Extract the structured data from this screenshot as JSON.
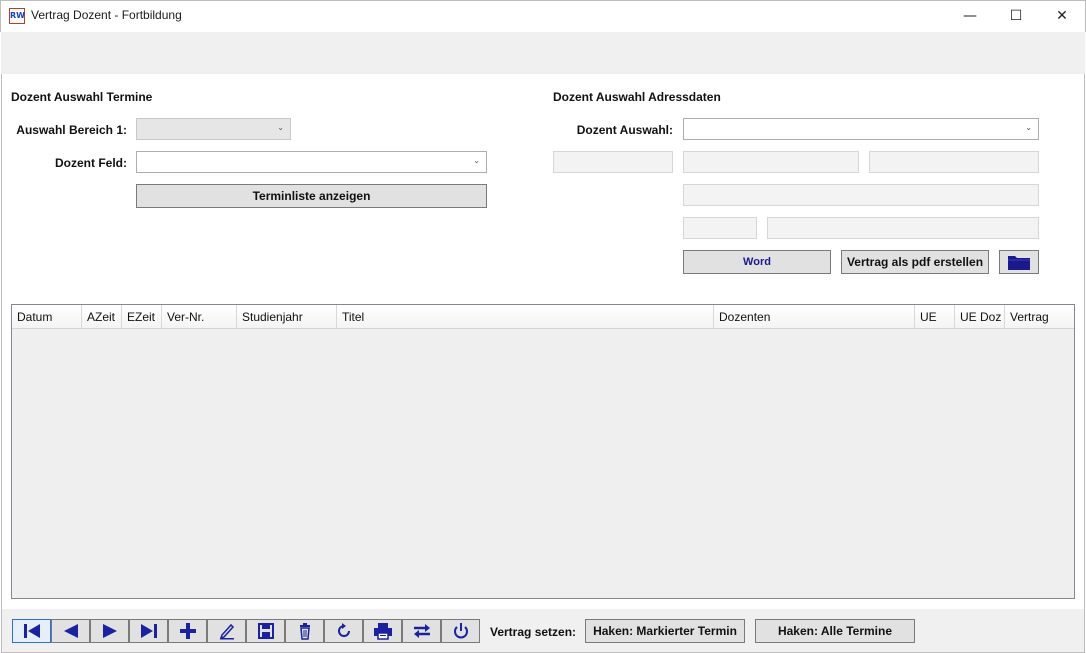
{
  "window": {
    "title": "Vertrag Dozent - Fortbildung",
    "app_icon_text": "RW",
    "minimize_glyph": "—",
    "maximize_glyph": "☐",
    "close_glyph": "✕"
  },
  "left_panel": {
    "title": "Dozent Auswahl Termine",
    "bereich_label": "Auswahl Bereich 1:",
    "bereich_value": "",
    "feld_label": "Dozent Feld:",
    "feld_value": "",
    "terminliste_button": "Terminliste anzeigen"
  },
  "right_panel": {
    "title": "Dozent Auswahl Adressdaten",
    "auswahl_label": "Dozent Auswahl:",
    "auswahl_value": "",
    "fields": [
      "",
      "",
      "",
      "",
      "",
      ""
    ],
    "word_button": "Word",
    "pdf_button": "Vertrag als pdf erstellen",
    "folder_icon": "folder-icon"
  },
  "grid": {
    "columns": [
      "Datum",
      "AZeit",
      "EZeit",
      "Ver-Nr.",
      "Studienjahr",
      "Titel",
      "Dozenten",
      "UE",
      "UE Doz",
      "Vertrag"
    ],
    "rows": []
  },
  "toolbar": {
    "icons": [
      "first-record-icon",
      "previous-record-icon",
      "next-record-icon",
      "last-record-icon",
      "add-icon",
      "edit-icon",
      "save-icon",
      "delete-icon",
      "refresh-icon",
      "print-icon",
      "swap-icon",
      "power-icon"
    ],
    "vertrag_label": "Vertrag setzen:",
    "haken_markiert_button": "Haken: Markierter Termin",
    "haken_alle_button": "Haken: Alle Termine"
  },
  "colors": {
    "accent_blue": "#1a1a8c",
    "icon_blue": "#1a22a0",
    "background": "#f0f0f0",
    "button_face": "#e1e1e1"
  }
}
